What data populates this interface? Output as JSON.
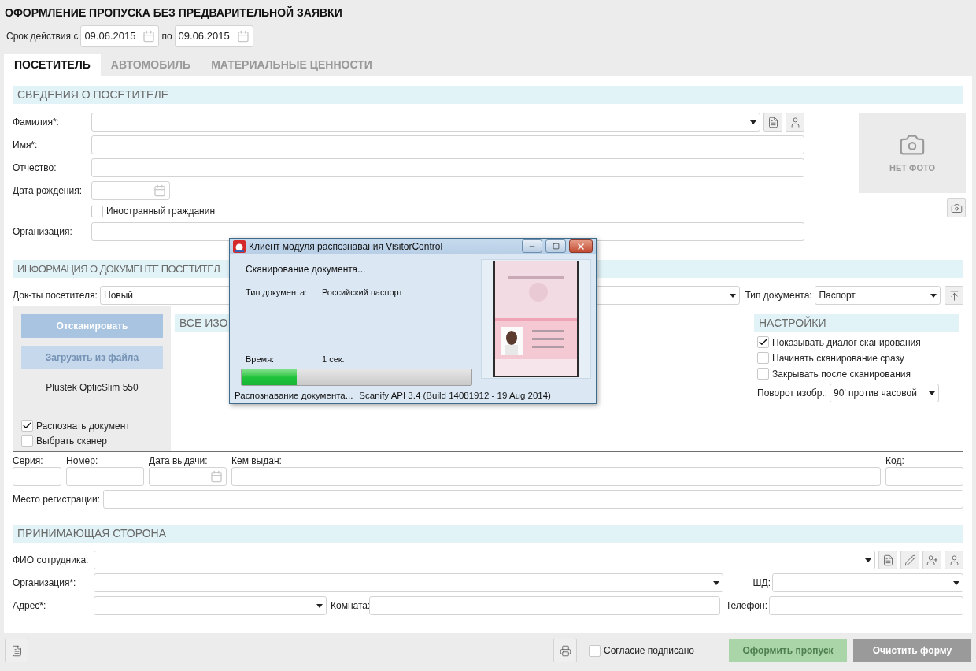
{
  "title": "ОФОРМЛЕНИЕ ПРОПУСКА БЕЗ ПРЕДВАРИТЕЛЬНОЙ ЗАЯВКИ",
  "validity": {
    "label": "Срок действия с",
    "from": "09.06.2015",
    "to_label": "по",
    "to": "09.06.2015"
  },
  "tabs": [
    {
      "label": "ПОСЕТИТЕЛЬ",
      "selected": true
    },
    {
      "label": "АВТОМОБИЛЬ",
      "selected": false
    },
    {
      "label": "МАТЕРИАЛЬНЫЕ ЦЕННОСТИ",
      "selected": false
    }
  ],
  "visitor": {
    "header": "СВЕДЕНИЯ О ПОСЕТИТЕЛЕ",
    "photo_caption": "НЕТ ФОТО",
    "fields": [
      {
        "label": "Фамилия*:",
        "kind": "combo"
      },
      {
        "label": "Имя*:",
        "kind": "text"
      },
      {
        "label": "Отчество:",
        "kind": "text"
      },
      {
        "label": "Дата рождения:",
        "kind": "date"
      },
      {
        "label": "Иностранный гражданин",
        "kind": "checkbox",
        "checked": false
      },
      {
        "label": "Организация:",
        "kind": "text"
      }
    ]
  },
  "document": {
    "header": "ИНФОРМАЦИЯ О ДОКУМЕНТЕ ПОСЕТИТЕЛ",
    "docs_label": "Док-ты посетителя:",
    "docs_value": "Новый",
    "type_label": "Тип документа:",
    "type_value": "Паспорт",
    "scanner": {
      "buttons": [
        {
          "label": "Отсканировать",
          "disabled": false
        },
        {
          "label": "Загрузить из файла",
          "disabled": true
        }
      ],
      "device": "Plustek OpticSlim 550",
      "options": [
        {
          "label": "Распознать документ",
          "checked": true
        },
        {
          "label": "Выбрать сканер",
          "checked": false
        }
      ]
    },
    "images_header": "ВСЕ ИЗО",
    "settings": {
      "header": "НАСТРОЙКИ",
      "options": [
        {
          "label": "Показывать диалог сканирования",
          "checked": true
        },
        {
          "label": "Начинать сканирование сразу",
          "checked": false
        },
        {
          "label": "Закрывать после сканирования",
          "checked": false
        }
      ],
      "rotation_label": "Поворот изобр.:",
      "rotation_value": "90' против часовой"
    },
    "fields": [
      {
        "label": "Серия:",
        "kind": "text"
      },
      {
        "label": "Номер:",
        "kind": "text"
      },
      {
        "label": "Дата выдачи:",
        "kind": "date"
      },
      {
        "label": "Кем выдан:",
        "kind": "text"
      },
      {
        "label": "Код:",
        "kind": "text"
      }
    ],
    "registration_label": "Место регистрации:"
  },
  "host": {
    "header": "ПРИНИМАЮЩАЯ СТОРОНА",
    "employee_label": "ФИО сотрудника:",
    "org_label": "Организация*:",
    "shd_label": "ШД:",
    "address_label": "Адрес*:",
    "room_label": "Комната:",
    "phone_label": "Телефон:"
  },
  "footer": {
    "consent": {
      "label": "Согласие подписано",
      "checked": false
    },
    "buttons": [
      {
        "label": "Оформить пропуск",
        "disabled": true
      },
      {
        "label": "Очистить форму",
        "disabled": false
      }
    ]
  },
  "dialog": {
    "title": "Клиент модуля распознавания VisitorControl",
    "status": "Сканирование документа...",
    "doc_type_label": "Тип документа:",
    "doc_type_value": "Российский паспорт",
    "time_label": "Время:",
    "time_value": "1 сек.",
    "level": 0.24,
    "status_bar": [
      "Распознавание документа...",
      "Scanify API 3.4 (Build 14081912 - 19 Aug 2014)"
    ]
  }
}
